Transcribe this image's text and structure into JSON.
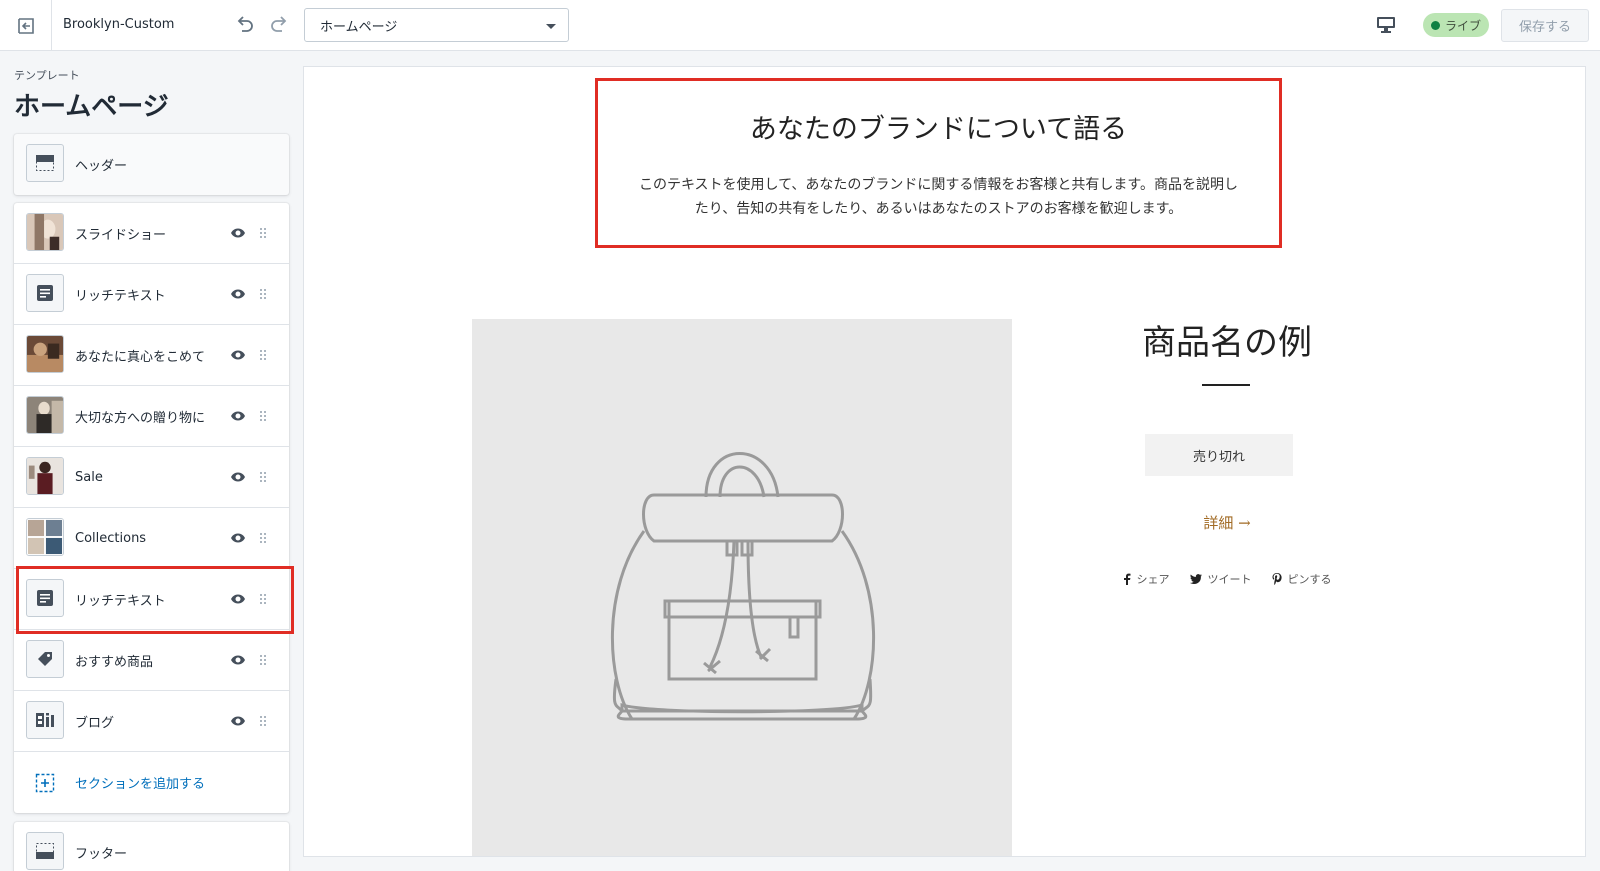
{
  "topbar": {
    "theme_name": "Brooklyn-Custom",
    "page_select_value": "ホームページ",
    "live_label": "ライブ",
    "save_label": "保存する"
  },
  "sidebar": {
    "subtitle": "テンプレート",
    "title": "ホームページ",
    "header_label": "ヘッダー",
    "sections": [
      {
        "label": "スライドショー",
        "thumb": "photo"
      },
      {
        "label": "リッチテキスト",
        "thumb": "text-icon"
      },
      {
        "label": "あなたに真心をこめて",
        "thumb": "photo"
      },
      {
        "label": "大切な方への贈り物に",
        "thumb": "photo"
      },
      {
        "label": "Sale",
        "thumb": "photo"
      },
      {
        "label": "Collections",
        "thumb": "photo"
      },
      {
        "label": "リッチテキスト",
        "thumb": "text-icon"
      },
      {
        "label": "おすすめ商品",
        "thumb": "tag-icon"
      },
      {
        "label": "ブログ",
        "thumb": "blog-icon"
      }
    ],
    "add_section_label": "セクションを追加する",
    "footer_label": "フッター"
  },
  "preview": {
    "brand_heading": "あなたのブランドについて語る",
    "brand_text": "このテキストを使用して、あなたのブランドに関する情報をお客様と共有します。商品を説明したり、告知の共有をしたり、あるいはあなたのストアのお客様を歓迎します。",
    "product_title": "商品名の例",
    "sold_out_label": "売り切れ",
    "details_label": "詳細 →",
    "share_facebook": "シェア",
    "share_twitter": "ツイート",
    "share_pinterest": "ピンする"
  },
  "colors": {
    "highlight": "#e02d24",
    "link": "#006fbb",
    "live_badge_bg": "#bbe5b3",
    "accent_link": "#a26b25"
  }
}
